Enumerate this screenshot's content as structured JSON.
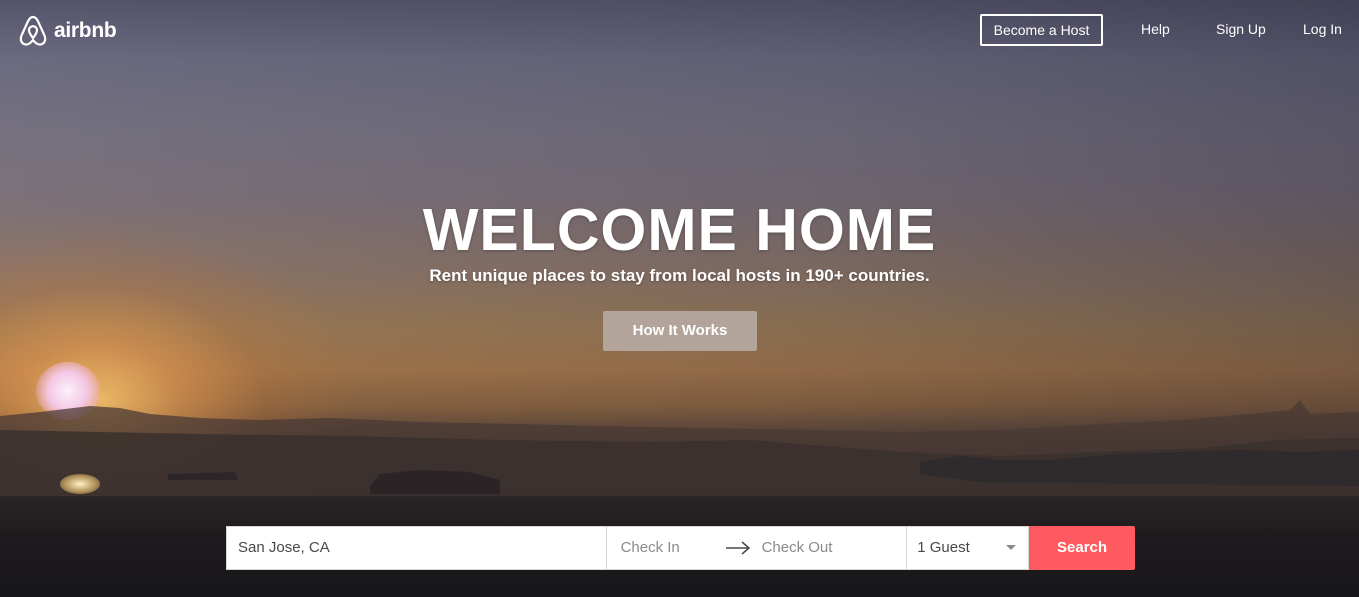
{
  "brand": {
    "name": "airbnb",
    "color": "#ff5a5f"
  },
  "nav": {
    "become_host": "Become a Host",
    "help": "Help",
    "sign_up": "Sign Up",
    "log_in": "Log In"
  },
  "hero": {
    "headline": "WELCOME HOME",
    "tagline": "Rent unique places to stay from local hosts in 190+ countries.",
    "how_it_works": "How It Works"
  },
  "search": {
    "location_value": "San Jose, CA",
    "check_in_placeholder": "Check In",
    "check_out_placeholder": "Check Out",
    "guests_selected": "1 Guest",
    "search_label": "Search"
  },
  "icons": {
    "logo": "airbnb-belo-icon",
    "date_arrow": "arrow-right-icon",
    "guests_caret": "caret-down-icon"
  }
}
